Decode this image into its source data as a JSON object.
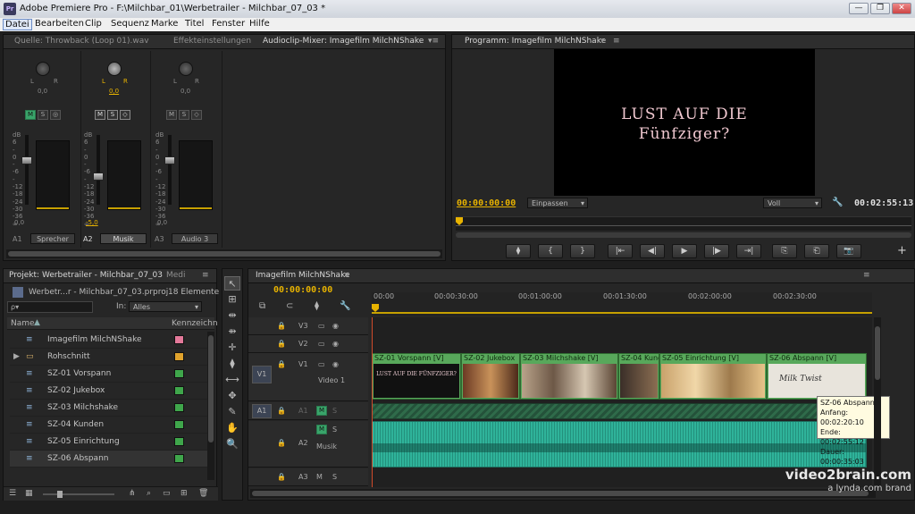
{
  "window": {
    "title": "Adobe Premiere Pro - F:\\Milchbar_01\\Werbetrailer - Milchbar_07_03 *",
    "icon_text": "Pr",
    "min": "—",
    "max": "❐",
    "close": "✕"
  },
  "menu": [
    "Datei",
    "Bearbeiten",
    "Clip",
    "Sequenz",
    "Marke",
    "Titel",
    "Fenster",
    "Hilfe"
  ],
  "source_panel": {
    "tabs": [
      "Quelle: Throwback (Loop 01).wav",
      "Effekteinstellungen",
      "Audioclip-Mixer: Imagefilm MilchNShake"
    ]
  },
  "mixer": {
    "lr": "L",
    "lr_r": "R",
    "db_scale": [
      "dB",
      "6",
      "-",
      "0",
      "-",
      "-6",
      "-",
      "-12",
      "-18",
      "-24",
      "-30",
      "-36",
      "∞"
    ],
    "channels": [
      {
        "id": "A1",
        "name": "Sprecher",
        "pan": "0,0",
        "fader": "0,0",
        "m": "M",
        "s": "S",
        "r": "◎",
        "active": false
      },
      {
        "id": "A2",
        "name": "Musik",
        "pan": "0,0",
        "fader": "-5,0",
        "m": "M",
        "s": "S",
        "r": "◇",
        "active": true
      },
      {
        "id": "A3",
        "name": "Audio 3",
        "pan": "0,0",
        "fader": "0,0",
        "m": "M",
        "s": "S",
        "r": "◇",
        "active": false
      }
    ]
  },
  "program": {
    "tab": "Programm: Imagefilm MilchNShake",
    "overlay": [
      "Lust auf die",
      "Fünfziger?"
    ],
    "timecode": "00:00:00:00",
    "fit": "Einpassen",
    "quality": "Voll",
    "duration": "00:02:55:13",
    "wrench": "🔧",
    "transport": [
      "⧫",
      "{",
      "}",
      "|⇤",
      "◀|",
      "▶",
      "|▶",
      "⇥|",
      "⎘",
      "⎗",
      "📷"
    ],
    "plus": "+"
  },
  "project": {
    "tabs": [
      "Projekt: Werbetrailer - Milchbar_07_03",
      "Medi"
    ],
    "file": "Werbetr...r - Milchbar_07_03.prproj",
    "count": "18 Elemente",
    "search_placeholder": "ρ▾",
    "in_label": "In:",
    "in_value": "Alles",
    "col_name": "Name",
    "col_label": "Kennzeichn",
    "items": [
      {
        "name": "Imagefilm MilchNShake",
        "color": "#e3799a",
        "icon": "seq"
      },
      {
        "name": "Rohschnitt",
        "color": "#e0a32d",
        "icon": "bin"
      },
      {
        "name": "SZ-01 Vorspann",
        "color": "#3fa64b",
        "icon": "seq"
      },
      {
        "name": "SZ-02 Jukebox",
        "color": "#3fa64b",
        "icon": "seq"
      },
      {
        "name": "SZ-03 Milchshake",
        "color": "#3fa64b",
        "icon": "seq"
      },
      {
        "name": "SZ-04 Kunden",
        "color": "#3fa64b",
        "icon": "seq"
      },
      {
        "name": "SZ-05 Einrichtung",
        "color": "#3fa64b",
        "icon": "seq"
      },
      {
        "name": "SZ-06 Abspann",
        "color": "#3fa64b",
        "icon": "seq"
      }
    ]
  },
  "tools": [
    "↖",
    "⊞",
    "⇹",
    "⇻",
    "✛",
    "⧫",
    "⟷",
    "✥",
    "✎",
    "✋",
    "🔍"
  ],
  "timeline": {
    "tab": "Imagefilm MilchNShake",
    "timecode": "00:00:00:00",
    "ruler": [
      "00:00",
      "00:00:30:00",
      "00:01:00:00",
      "00:01:30:00",
      "00:02:00:00",
      "00:02:30:00"
    ],
    "tracks": {
      "v3": "V3",
      "v2": "V2",
      "v1": "V1",
      "v1_src": "V1",
      "video1": "Video 1",
      "a1": "A1",
      "a1_src": "A1",
      "a2": "A2",
      "a2_name": "Musik",
      "a3": "A3",
      "a3_src": "A3",
      "m": "M",
      "s": "S"
    },
    "clips": [
      {
        "name": "SZ-01 Vorspann [V]",
        "thumb": "LUST AUF DIE FÜNFZIGER?"
      },
      {
        "name": "SZ-02 Jukebox"
      },
      {
        "name": "SZ-03 Milchshake [V]"
      },
      {
        "name": "SZ-04 Kund"
      },
      {
        "name": "SZ-05 Einrichtung [V]"
      },
      {
        "name": "SZ-06 Abspann [V]",
        "thumb": "Milk Twist"
      }
    ],
    "tooltip": {
      "title": "SZ-06 Abspann",
      "start": "Anfang: 00:02:20:10",
      "end": "Ende: 00:02:55:12",
      "dur": "Dauer: 00:00:35:03"
    }
  },
  "watermark": {
    "brand": "video2brain.com",
    "sub": "a lynda.com brand"
  },
  "colors": {
    "accent": "#e8b300",
    "clip_video": "#58a85b",
    "clip_audio": "#2fb39a"
  }
}
